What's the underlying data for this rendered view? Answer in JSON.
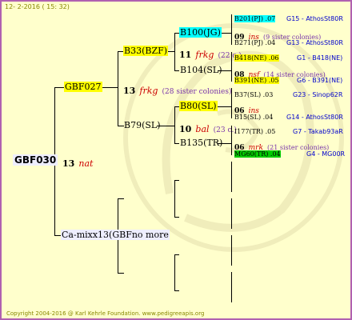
{
  "header": {
    "date": "12- 2-2016 ( 15: 32)"
  },
  "footer": {
    "copyright": "Copyright 2004-2016 @ Karl Kehrle Foundation.     www.pedigreeapis.org"
  },
  "root": {
    "label": "GBF030",
    "num": "13",
    "code": "nat"
  },
  "gen1": {
    "top": {
      "label": "GBF027"
    },
    "mid": {
      "num": "13",
      "code": "frkg",
      "note": "(28 sister colonies)"
    },
    "bottom": {
      "label": "Ca-mixx13(GBF",
      "more": "no more"
    }
  },
  "gen2": {
    "a": {
      "label": "B33(BZF)"
    },
    "a_mid": {
      "num": "11",
      "code": "frkg",
      "note": "(22 c.)"
    },
    "b": {
      "label": "B79(SL)"
    },
    "b_mid": {
      "num": "10",
      "code": "bal",
      "note": "(23 c.)"
    }
  },
  "gen3": {
    "a": {
      "label": "B100(JG)"
    },
    "a_mid": {
      "num": "09",
      "code": "ins",
      "note": "(9 sister colonies)"
    },
    "b": {
      "label": "B104(SL)"
    },
    "b_mid": {
      "num": "08",
      "code": "nsf",
      "note": "(14 sister colonies)"
    },
    "c": {
      "label": "B80(SL)"
    },
    "c_mid": {
      "num": "06",
      "code": "ins"
    },
    "d": {
      "label": "B135(TR)"
    },
    "d_mid": {
      "num": "06",
      "code": "mrk",
      "note": "(21 sister colonies)"
    }
  },
  "gen4": [
    {
      "label": "B201(PJ) .07",
      "code": "G15 - AthosSt80R"
    },
    {
      "label": "B271(PJ) .04",
      "code": "G13 - AthosSt80R"
    },
    {
      "label": "B418(NE) .06",
      "code": "G1 - B418(NE)"
    },
    {
      "label": "B391(NE) .05",
      "code": "G6 - B391(NE)"
    },
    {
      "label": "B37(SL) .03",
      "code": "G23 - Sinop62R"
    },
    {
      "label": "B15(SL) .04",
      "code": "G14 - AthosSt80R"
    },
    {
      "label": "I177(TR) .05",
      "code": "G7 - Takab93aR"
    },
    {
      "label": "MG60(TR) .04",
      "code": "G4 - MG00R"
    }
  ],
  "colors": {
    "frame": "#b060b0",
    "background": "#ffffcc",
    "highlight_yellow": "#ffff00",
    "highlight_cyan": "#00ffff",
    "highlight_green": "#00cc00"
  }
}
